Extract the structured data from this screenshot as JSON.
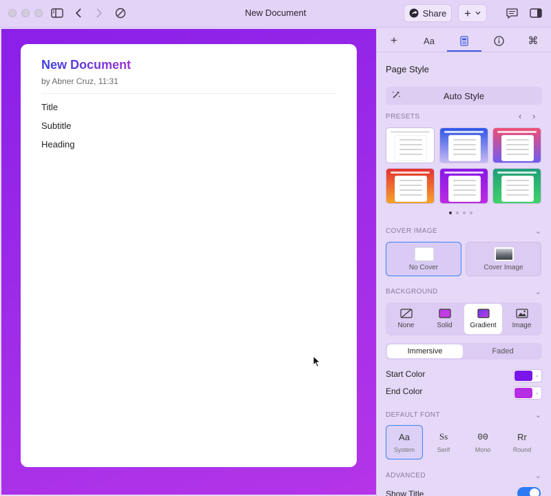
{
  "window": {
    "title": "New Document",
    "share_label": "Share"
  },
  "document": {
    "title": "New Document",
    "meta": "by Abner Cruz, 11:31",
    "lines": [
      "Title",
      "Subtitle",
      "Heading"
    ]
  },
  "panel": {
    "tabs": [
      "add",
      "Aa",
      "page-style",
      "info",
      "command"
    ],
    "active_tab": "page-style",
    "page_style_title": "Page Style",
    "auto_style_label": "Auto Style",
    "presets": {
      "heading": "PRESETS",
      "page": 1,
      "page_count": 4,
      "items": [
        {
          "name": "white",
          "colors": [
            "#ffffff",
            "#ffffff"
          ]
        },
        {
          "name": "blue",
          "colors": [
            "#2f56e8",
            "#c6b9f3"
          ]
        },
        {
          "name": "pink-purple",
          "colors": [
            "#ef4f74",
            "#6f5cf0"
          ]
        },
        {
          "name": "red-orange",
          "colors": [
            "#e53232",
            "#f7a32a"
          ]
        },
        {
          "name": "purple",
          "colors": [
            "#8a17e6",
            "#bb2be4"
          ]
        },
        {
          "name": "green",
          "colors": [
            "#1e9e78",
            "#3fd36a"
          ]
        }
      ]
    },
    "cover_image": {
      "heading": "COVER IMAGE",
      "options": [
        "No Cover",
        "Cover Image"
      ],
      "selected": "No Cover"
    },
    "background": {
      "heading": "BACKGROUND",
      "options": [
        "None",
        "Solid",
        "Gradient",
        "Image"
      ],
      "selected": "Gradient",
      "modes": [
        "Immersive",
        "Faded"
      ],
      "mode_selected": "Immersive",
      "start_color_label": "Start Color",
      "start_color": "#7a17e8",
      "end_color_label": "End Color",
      "end_color": "#b62be4"
    },
    "default_font": {
      "heading": "DEFAULT FONT",
      "options": [
        {
          "glyph": "Aa",
          "label": "System"
        },
        {
          "glyph": "Ss",
          "label": "Serif"
        },
        {
          "glyph": "00",
          "label": "Mono"
        },
        {
          "glyph": "Rr",
          "label": "Round"
        }
      ],
      "selected": "System"
    },
    "advanced": {
      "heading": "ADVANCED",
      "show_title_label": "Show Title",
      "show_title_on": true
    }
  }
}
